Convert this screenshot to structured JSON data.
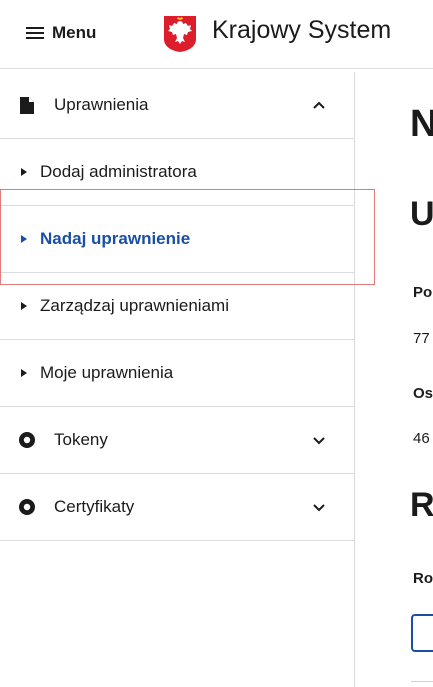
{
  "header": {
    "menu_label": "Menu",
    "title": "Krajowy System"
  },
  "sidebar": {
    "sections": [
      {
        "label": "Uprawnienia",
        "icon": "document-icon",
        "expanded": true,
        "items": [
          {
            "label": "Dodaj administratora",
            "active": false
          },
          {
            "label": "Nadaj uprawnienie",
            "active": true
          },
          {
            "label": "Zarządzaj uprawnieniami",
            "active": false
          },
          {
            "label": "Moje uprawnienia",
            "active": false
          }
        ]
      },
      {
        "label": "Tokeny",
        "icon": "target-icon",
        "expanded": false
      },
      {
        "label": "Certyfikaty",
        "icon": "target-icon",
        "expanded": false
      }
    ]
  },
  "main": {
    "heading": "N",
    "subheading": "U",
    "field1_label": "Po",
    "field1_value": "77",
    "field2_label": "Os",
    "field2_value": "46",
    "section_heading": "R",
    "field3_label": "Ro"
  },
  "colors": {
    "accent": "#1a4fa3",
    "highlight_border": "#e07b7b",
    "divider": "#dcdcdc"
  }
}
